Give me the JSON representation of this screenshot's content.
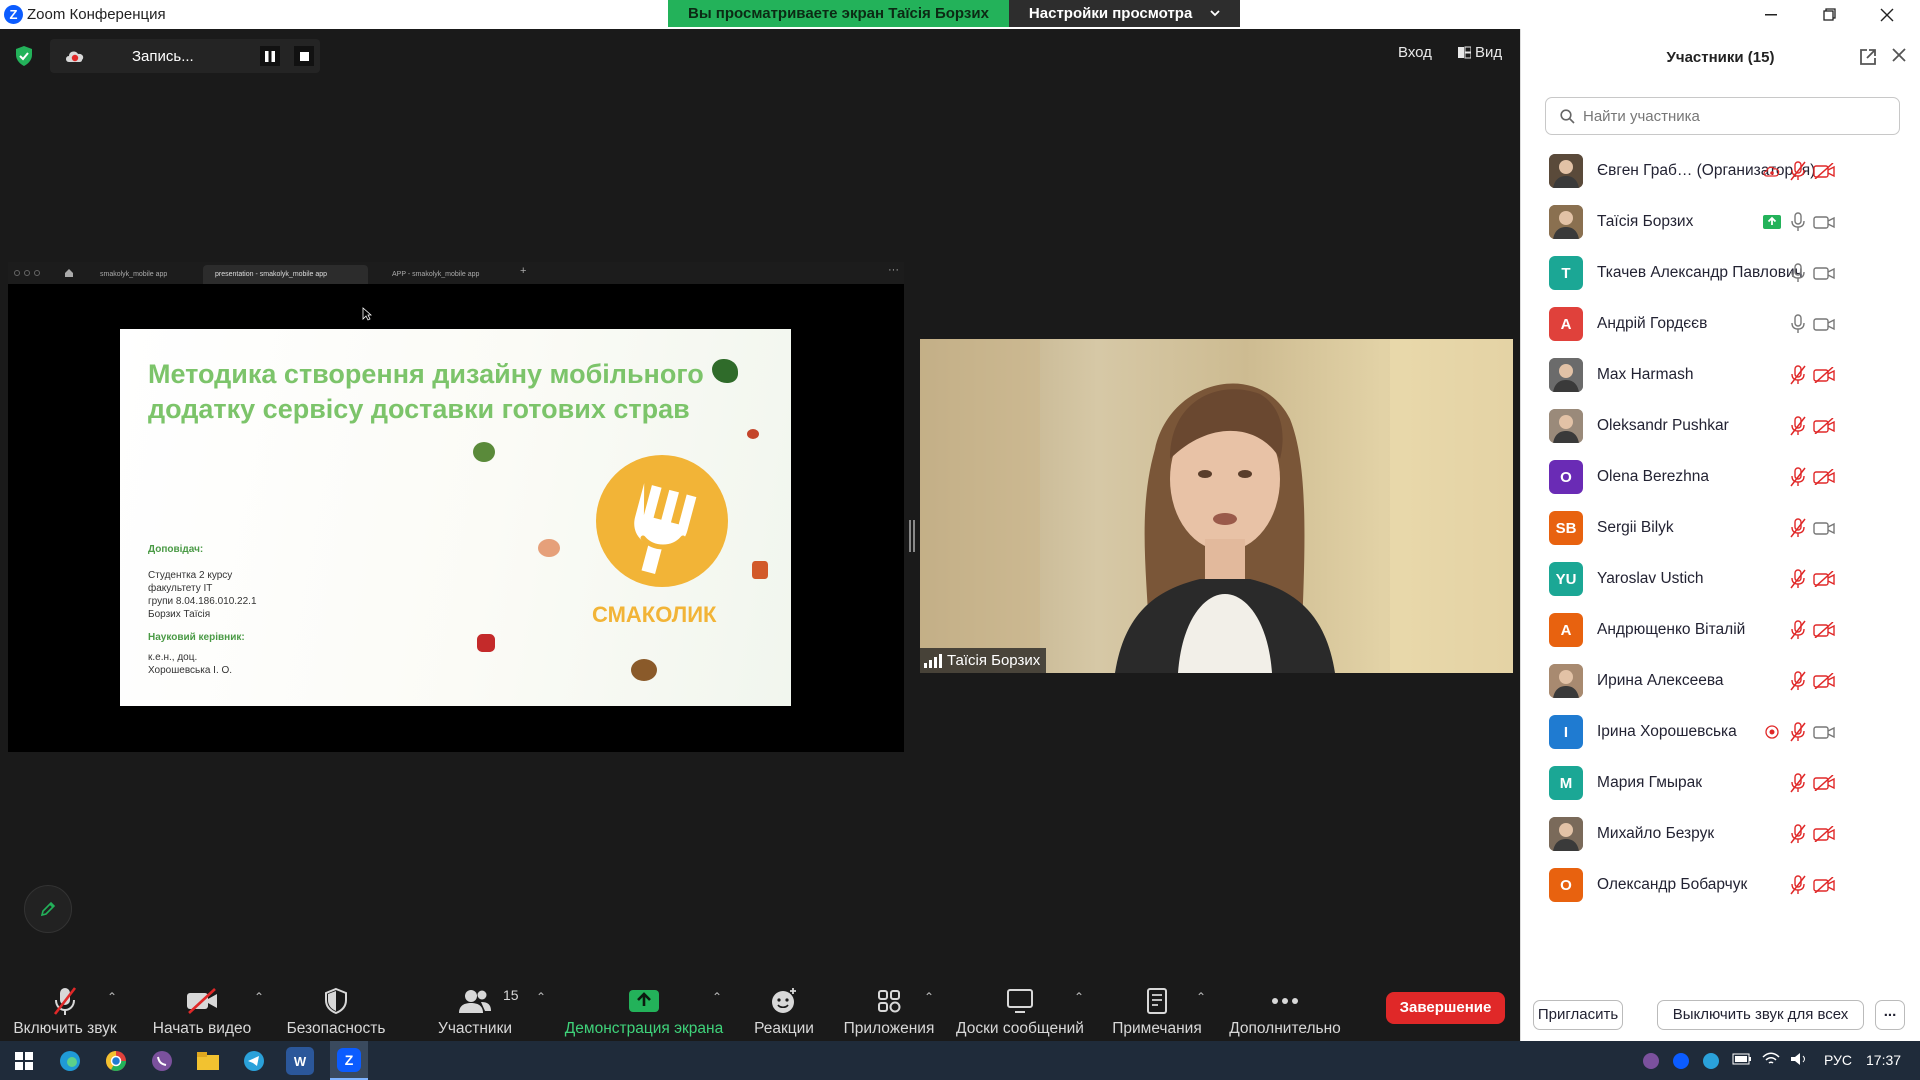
{
  "window": {
    "title": "Zoom Конференция",
    "icon": "zoom-logo-icon"
  },
  "share_banner": {
    "message": "Вы просматриваете экран Таїсія Борзих",
    "options_label": "Настройки просмотра"
  },
  "recording": {
    "label": "Запись..."
  },
  "top_right": {
    "signin": "Вход",
    "view": "Вид"
  },
  "browser_tabs": [
    "smakolyk_mobile app",
    "presentation - smakolyk_mobile app",
    "APP - smakolyk_mobile app"
  ],
  "slide": {
    "title": "Методика створення дизайну мобільного додатку сервісу доставки готових страв",
    "presenter_label": "Доповідач:",
    "presenter_lines": [
      "Студентка 2 курсу",
      "факультету ІТ",
      "групи 8.04.186.010.22.1",
      "Борзих Таїсія"
    ],
    "supervisor_label": "Науковий керівник:",
    "supervisor_lines": [
      "к.е.н., доц.",
      "Хорошевська І. О."
    ],
    "brand": "СМАКОЛИК",
    "colors": {
      "title": "#7cc46a",
      "brand": "#f2b437"
    }
  },
  "speaker": {
    "name": "Таїсія Борзих"
  },
  "toolbar": {
    "unmute": "Включить звук",
    "start_video": "Начать видео",
    "security": "Безопасность",
    "participants": "Участники",
    "participants_count": "15",
    "share_screen": "Демонстрация экрана",
    "reactions": "Реакции",
    "apps": "Приложения",
    "whiteboards": "Доски сообщений",
    "notes": "Примечания",
    "more": "Дополнительно",
    "end": "Завершение"
  },
  "panel": {
    "title": "Участники (15)",
    "search_placeholder": "Найти участника",
    "invite": "Пригласить",
    "mute_all": "Выключить звук для всех",
    "more": "...",
    "participants": [
      {
        "name": "Євген Граб…  (Организатор, я)",
        "avatar": "photo",
        "avatar_color": "#5a4a3a",
        "mic": "muted",
        "video": "off",
        "extra": "cloud-record"
      },
      {
        "name": "Таїсія Борзих",
        "avatar": "photo",
        "avatar_color": "#8a7050",
        "mic": "on",
        "video": "on",
        "extra": "sharing"
      },
      {
        "name": "Ткачев Александр Павлович",
        "avatar": "Т",
        "avatar_color": "#1ba795",
        "mic": "on",
        "video": "on",
        "extra": ""
      },
      {
        "name": "Андрій Гордєєв",
        "avatar": "А",
        "avatar_color": "#e0413b",
        "mic": "on",
        "video": "on",
        "extra": ""
      },
      {
        "name": "Max Harmash",
        "avatar": "photo",
        "avatar_color": "#6b6b6b",
        "mic": "muted",
        "video": "off",
        "extra": ""
      },
      {
        "name": "Oleksandr Pushkar",
        "avatar": "photo",
        "avatar_color": "#9a8a7a",
        "mic": "muted",
        "video": "off",
        "extra": ""
      },
      {
        "name": "Olena Berezhna",
        "avatar": "O",
        "avatar_color": "#6a2bb5",
        "mic": "muted",
        "video": "off",
        "extra": ""
      },
      {
        "name": "Sergii Bilyk",
        "avatar": "SB",
        "avatar_color": "#e8620f",
        "mic": "muted",
        "video": "on",
        "extra": ""
      },
      {
        "name": "Yaroslav Ustich",
        "avatar": "YU",
        "avatar_color": "#1ba795",
        "mic": "muted",
        "video": "off",
        "extra": ""
      },
      {
        "name": "Андрющенко Віталій",
        "avatar": "А",
        "avatar_color": "#e8620f",
        "mic": "muted",
        "video": "off",
        "extra": ""
      },
      {
        "name": "Ирина Алексеева",
        "avatar": "photo",
        "avatar_color": "#a88a70",
        "mic": "muted",
        "video": "off",
        "extra": ""
      },
      {
        "name": "Ірина Хорошевська",
        "avatar": "І",
        "avatar_color": "#1f7bd1",
        "mic": "muted",
        "video": "on",
        "extra": "record-dot"
      },
      {
        "name": "Мария Гмырак",
        "avatar": "М",
        "avatar_color": "#1ba795",
        "mic": "muted",
        "video": "off",
        "extra": ""
      },
      {
        "name": "Михайло Безрук",
        "avatar": "photo",
        "avatar_color": "#7a6a5a",
        "mic": "muted",
        "video": "off",
        "extra": ""
      },
      {
        "name": "Олександр Бобарчук",
        "avatar": "О",
        "avatar_color": "#e8620f",
        "mic": "muted",
        "video": "off",
        "extra": ""
      }
    ]
  },
  "taskbar": {
    "lang": "РУС",
    "time": "17:37"
  }
}
